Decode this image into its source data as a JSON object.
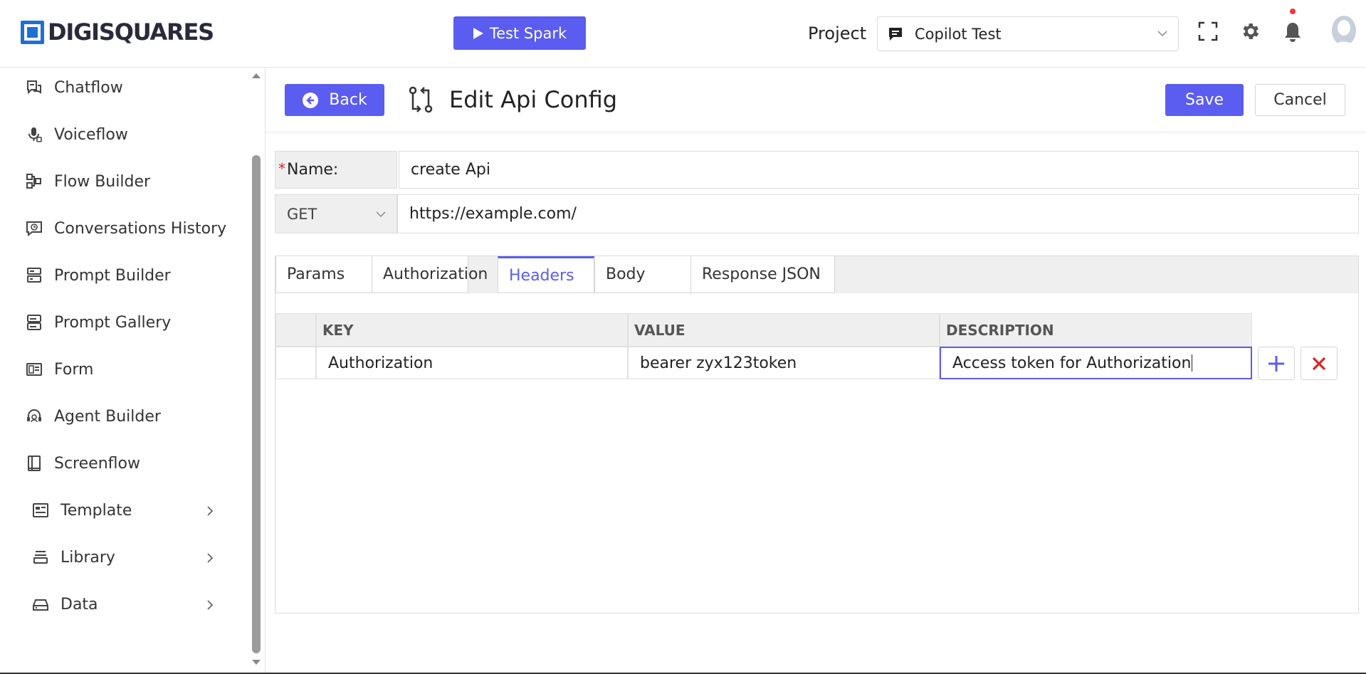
{
  "brand": {
    "name": "DIGISQUARES",
    "accent": "#5b5cf0"
  },
  "topbar": {
    "test_button_label": "Test Spark",
    "project_label": "Project",
    "project_value": "Copilot Test"
  },
  "sidebar": {
    "items": [
      {
        "label": "Chatflow",
        "icon": "chatflow-icon"
      },
      {
        "label": "Voiceflow",
        "icon": "microphone-icon"
      },
      {
        "label": "Flow Builder",
        "icon": "flow-builder-icon"
      },
      {
        "label": "Conversations History",
        "icon": "history-icon"
      },
      {
        "label": "Prompt Builder",
        "icon": "prompt-builder-icon"
      },
      {
        "label": "Prompt Gallery",
        "icon": "gallery-icon"
      },
      {
        "label": "Form",
        "icon": "form-icon"
      },
      {
        "label": "Agent Builder",
        "icon": "agent-icon"
      },
      {
        "label": "Screenflow",
        "icon": "screenflow-icon"
      }
    ],
    "groups": [
      {
        "label": "Template",
        "icon": "template-icon"
      },
      {
        "label": "Library",
        "icon": "library-icon"
      },
      {
        "label": "Data",
        "icon": "data-icon"
      }
    ]
  },
  "header": {
    "back_label": "Back",
    "title": "Edit Api Config",
    "save_label": "Save",
    "cancel_label": "Cancel"
  },
  "form": {
    "name_label": "Name:",
    "name_value": "create Api",
    "method": "GET",
    "url": "https://example.com/"
  },
  "tabs": [
    {
      "label": "Params",
      "active": false
    },
    {
      "label": "Authorization",
      "active": false
    },
    {
      "label": "Headers",
      "active": true
    },
    {
      "label": "Body",
      "active": false
    },
    {
      "label": "Response JSON",
      "active": false
    }
  ],
  "headers_table": {
    "columns": [
      "KEY",
      "VALUE",
      "DESCRIPTION"
    ],
    "rows": [
      {
        "key": "Authorization",
        "value": "bearer zyx123token",
        "description": "Access token for Authorization"
      }
    ]
  }
}
